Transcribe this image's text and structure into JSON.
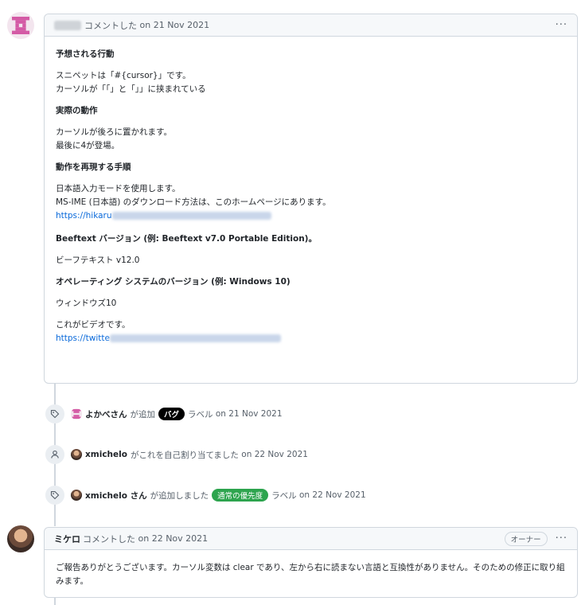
{
  "comment1": {
    "action": "コメントした",
    "date": "on 21 Nov 2021",
    "menu": "···",
    "expected_heading": "予想される行動",
    "expected_line1": "スニペットは「#{cursor}」です。",
    "expected_line2": "カーソルが「「」と「」」に挟まれている",
    "actual_heading": "実際の動作",
    "actual_line1": "カーソルが後ろに置かれます。",
    "actual_line2": "最後に4が登場。",
    "steps_heading": "動作を再現する手順",
    "steps_line1": "日本語入力モードを使用します。",
    "steps_line2": "MS-IME (日本語) のダウンロード方法は、このホームページにあります。",
    "steps_link": "https://hikaru",
    "beeftext_heading": "Beeftext バージョン (例: Beeftext v7.0 Portable Edition)。",
    "beeftext_value": "ビーフテキスト v12.0",
    "os_heading": "オペレーティング システムのバージョン (例: Windows 10)",
    "os_value": "ウィンドウズ10",
    "video_line": "これがビデオです。",
    "video_link": "https://twitte"
  },
  "events": [
    {
      "icon": "tag-icon",
      "user": "よかべさん",
      "verb": "が追加",
      "label": "バグ",
      "suffix": "ラベル",
      "date": "on 21 Nov 2021"
    },
    {
      "icon": "person-icon",
      "user": "xmichelo",
      "verb": "がこれを自己割り当てました",
      "date": "on 22 Nov 2021"
    },
    {
      "icon": "tag-icon",
      "user": "xmichelo さん",
      "verb": "が追加しました",
      "label": "通常の優先度",
      "suffix": "ラベル",
      "date": "on 22 Nov 2021"
    }
  ],
  "comment2": {
    "author": "ミケロ",
    "action": "コメントした",
    "date": "on 22 Nov 2021",
    "badge": "オーナー",
    "menu": "···",
    "body": "ご報告ありがとうございます。カーソル変数は clear であり、左から右に読まない言語と互換性がありません。そのための修正に取り組みます。"
  },
  "colors": {
    "bug_label": "#000000",
    "priority_label": "#2da44e",
    "link": "#0969da"
  }
}
